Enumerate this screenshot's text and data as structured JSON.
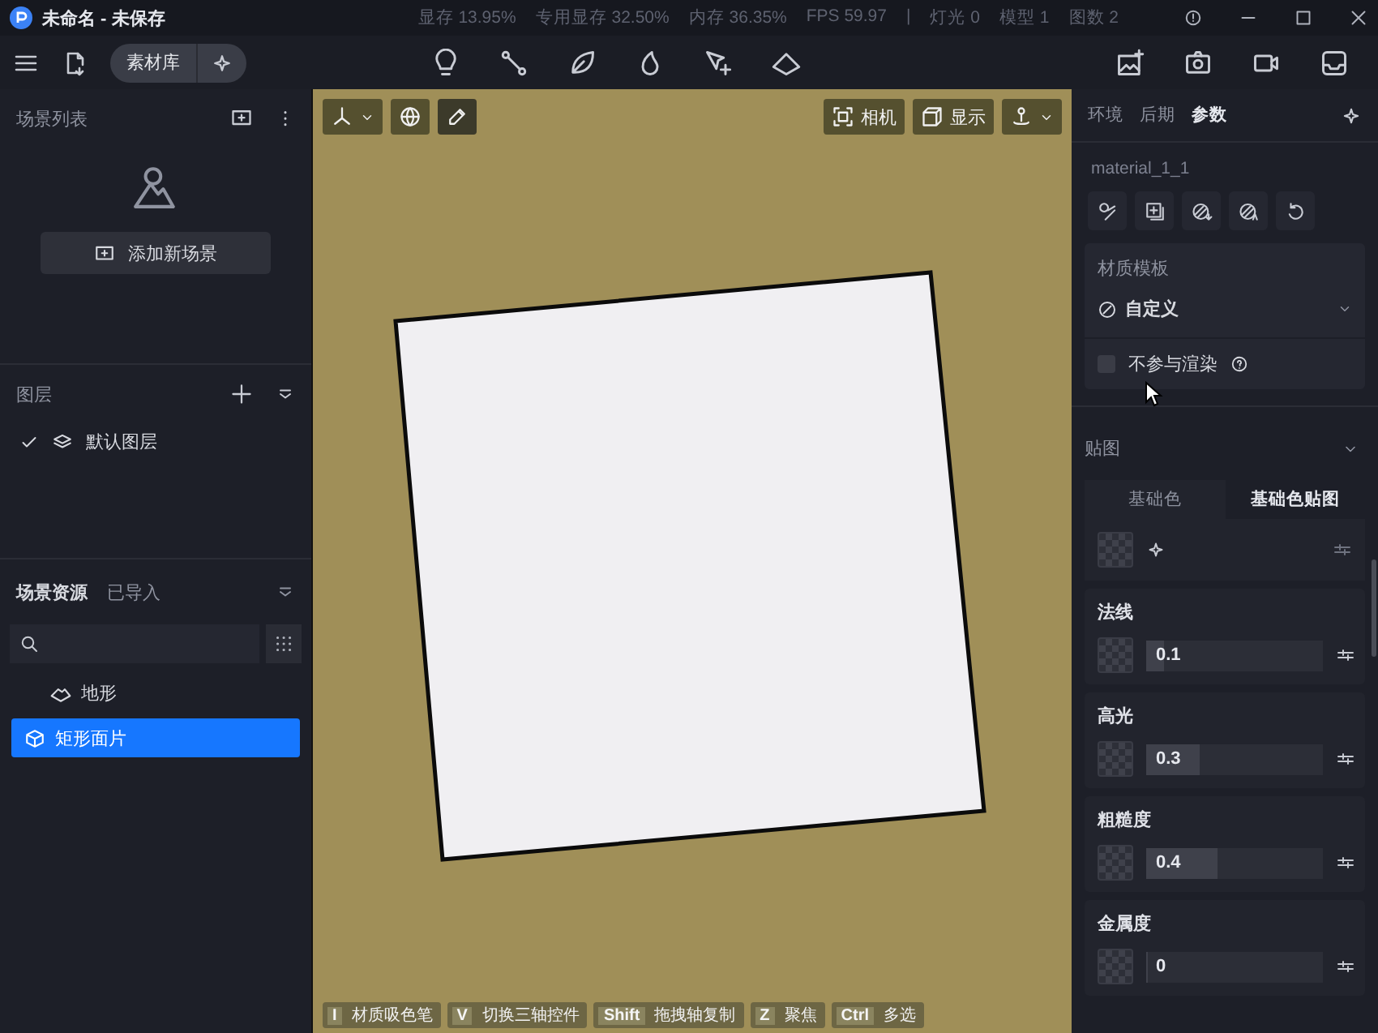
{
  "window": {
    "title": "未命名 - 未保存",
    "stats": [
      "显存 13.95%",
      "专用显存 32.50%",
      "内存 36.35%",
      "FPS 59.97",
      "|",
      "灯光 0",
      "模型 1",
      "图数 2"
    ]
  },
  "toolbar": {
    "library_button": "素材库"
  },
  "scene_list": {
    "title": "场景列表",
    "add_button": "添加新场景"
  },
  "layers": {
    "title": "图层",
    "items": [
      {
        "label": "默认图层",
        "checked": true
      }
    ]
  },
  "assets": {
    "tabs": [
      {
        "label": "场景资源",
        "selected": true
      },
      {
        "label": "已导入",
        "selected": false
      }
    ],
    "tree": [
      {
        "label": "地形",
        "kind": "terrain",
        "selected": false
      },
      {
        "label": "矩形面片",
        "kind": "plane",
        "selected": true
      }
    ]
  },
  "viewport": {
    "camera_button": "相机",
    "display_button": "显示",
    "shortcuts": [
      {
        "key": "I",
        "label": "材质吸色笔"
      },
      {
        "key": "V",
        "label": "切换三轴控件"
      },
      {
        "key": "Shift",
        "label": "拖拽轴复制"
      },
      {
        "key": "Z",
        "label": "聚焦"
      },
      {
        "key": "Ctrl",
        "label": "多选"
      }
    ]
  },
  "properties": {
    "tabs": [
      {
        "label": "环境",
        "selected": false
      },
      {
        "label": "后期",
        "selected": false
      },
      {
        "label": "参数",
        "selected": true
      }
    ],
    "material_name": "material_1_1",
    "template_label": "材质模板",
    "template_value": "自定义",
    "exclude_render": {
      "label": "不参与渲染",
      "checked": false
    },
    "maps_title": "贴图",
    "map_tabs": [
      {
        "label": "基础色",
        "selected": false
      },
      {
        "label": "基础色贴图",
        "selected": true
      }
    ],
    "channels": [
      {
        "name": "法线",
        "reading": "0.1",
        "level": 0.1
      },
      {
        "name": "高光",
        "reading": "0.3",
        "level": 0.3
      },
      {
        "name": "粗糙度",
        "reading": "0.4",
        "level": 0.4
      },
      {
        "name": "金属度",
        "reading": "0",
        "level": 0
      }
    ]
  }
}
